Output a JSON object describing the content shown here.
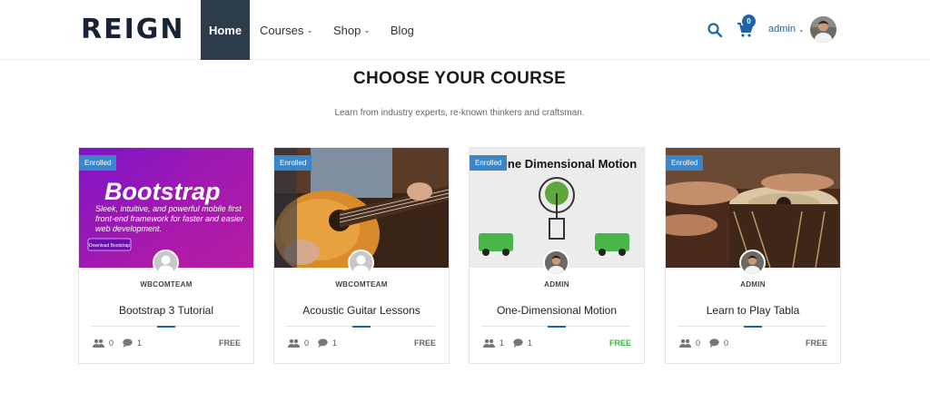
{
  "header": {
    "logo": "REIGN",
    "nav": [
      {
        "label": "Home",
        "caret": ""
      },
      {
        "label": "Courses",
        "caret": "⌄"
      },
      {
        "label": "Shop",
        "caret": "⌄"
      },
      {
        "label": "Blog",
        "caret": ""
      }
    ],
    "cart_count": "0",
    "user": "admin",
    "icons": [
      "search-icon",
      "cart-icon",
      "chevron-down-icon"
    ]
  },
  "section": {
    "title": "CHOOSE YOUR COURSE",
    "subtitle": "Learn from industry experts, re-known thinkers and craftsman."
  },
  "cards": [
    {
      "badge": "Enrolled",
      "author": "WBCOMTEAM",
      "title": "Bootstrap 3 Tutorial",
      "students": "0",
      "comments": "1",
      "price": "FREE",
      "image": {
        "heading": "Bootstrap",
        "tagline": "Sleek, intuitive, and powerful mobile first front-end framework for faster and easier web development.",
        "button": "Download Bootstrap"
      }
    },
    {
      "badge": "Enrolled",
      "author": "WBCOMTEAM",
      "title": "Acoustic Guitar Lessons",
      "students": "0",
      "comments": "1",
      "price": "FREE"
    },
    {
      "badge": "Enrolled",
      "author": "ADMIN",
      "title": "One-Dimensional Motion",
      "students": "1",
      "comments": "1",
      "price": "FREE",
      "image": {
        "heading": "One Dimensional Motion"
      }
    },
    {
      "badge": "Enrolled",
      "author": "ADMIN",
      "title": "Learn to Play Tabla",
      "students": "0",
      "comments": "0",
      "price": "FREE"
    }
  ],
  "colors": {
    "accent": "#1f64a8",
    "nav_active": "#2e3b4b",
    "badge": "#3a86c8",
    "free_green": "#2fbe3f"
  }
}
